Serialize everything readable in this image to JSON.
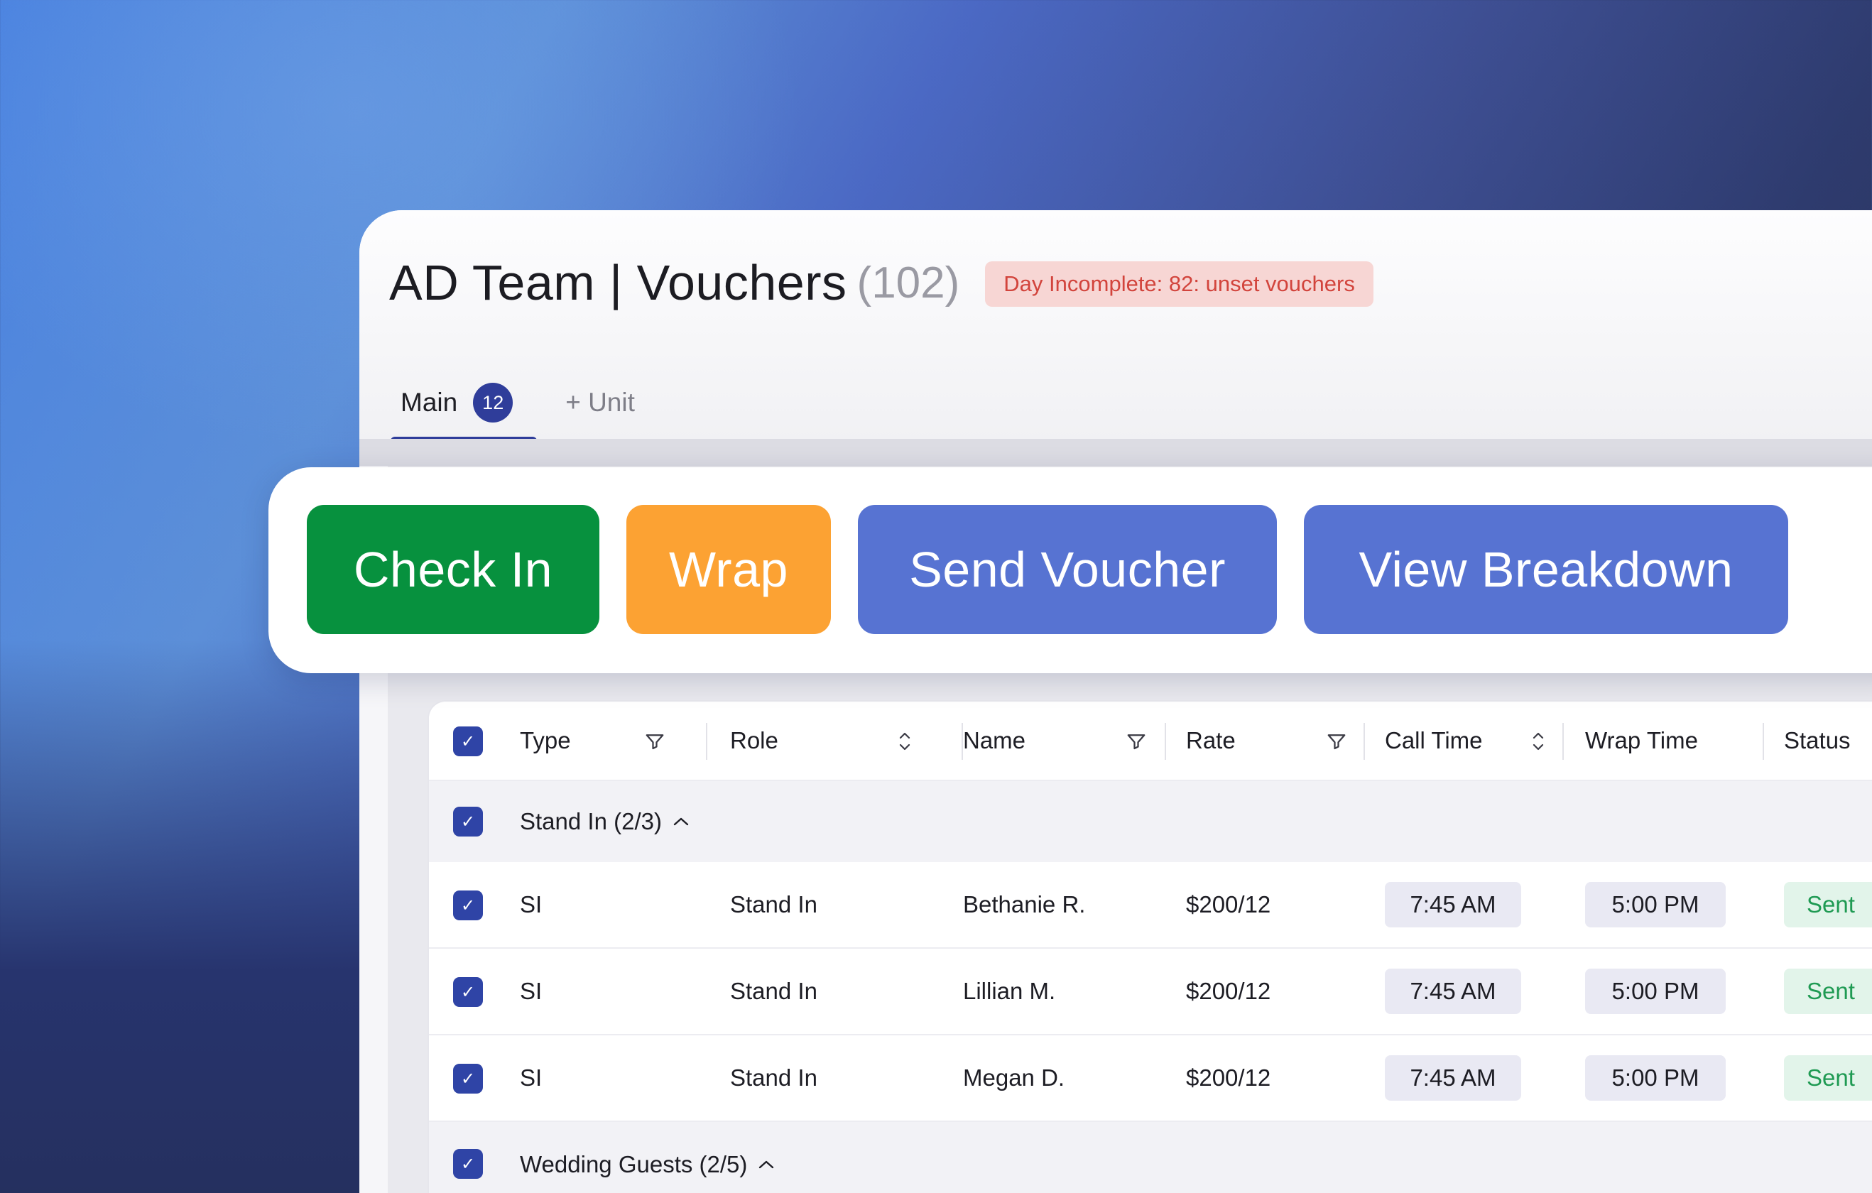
{
  "page": {
    "title": "AD Team | Vouchers",
    "count": "(102)",
    "alert": "Day Incomplete: 82: unset vouchers"
  },
  "tabs": [
    {
      "label": "Main",
      "count": "12",
      "active": true
    },
    {
      "label": "+ Unit",
      "active": false
    }
  ],
  "actions": {
    "check_in": "Check In",
    "wrap": "Wrap",
    "send_voucher": "Send Voucher",
    "view_breakdown": "View Breakdown"
  },
  "colors": {
    "check_in": "#07913e",
    "wrap": "#fca233",
    "primary": "#5773d2",
    "accent": "#2f3d9a",
    "alert_text": "#d2443c",
    "status_sent": "#1f9a53"
  },
  "table": {
    "columns": [
      "Type",
      "Role",
      "Name",
      "Rate",
      "Call Time",
      "Wrap Time",
      "Status"
    ],
    "groups": [
      {
        "label": "Stand In (2/3)",
        "rows": [
          {
            "type": "SI",
            "role": "Stand In",
            "name": "Bethanie R.",
            "rate": "$200/12",
            "call_time": "7:45 AM",
            "wrap_time": "5:00 PM",
            "status": "Sent"
          },
          {
            "type": "SI",
            "role": "Stand In",
            "name": "Lillian M.",
            "rate": "$200/12",
            "call_time": "7:45 AM",
            "wrap_time": "5:00 PM",
            "status": "Sent"
          },
          {
            "type": "SI",
            "role": "Stand In",
            "name": "Megan D.",
            "rate": "$200/12",
            "call_time": "7:45 AM",
            "wrap_time": "5:00 PM",
            "status": "Sent"
          }
        ]
      },
      {
        "label": "Wedding Guests (2/5)",
        "rows": []
      }
    ],
    "check_glyph": "✓"
  }
}
